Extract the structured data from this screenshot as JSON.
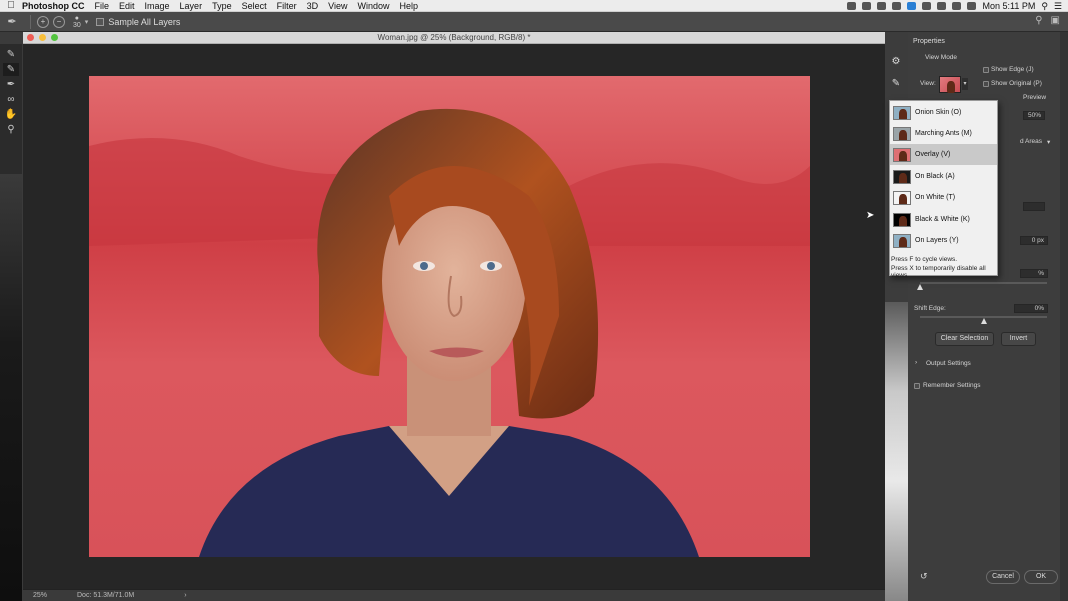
{
  "menubar": {
    "apple_icon": "apple-icon",
    "app_name": "Photoshop CC",
    "menus": [
      "File",
      "Edit",
      "Image",
      "Layer",
      "Type",
      "Select",
      "Filter",
      "3D",
      "View",
      "Window",
      "Help"
    ],
    "clock": "Mon 5:11 PM"
  },
  "optionsbar": {
    "brush_size": "30",
    "sample_all_layers": "Sample All Layers"
  },
  "document": {
    "title": "Woman.jpg @ 25% (Background, RGB/8) *",
    "zoom": "25%",
    "doc_size": "Doc: 51.3M/71.0M",
    "photo_colors": {
      "background": "#db4f55",
      "hair": "#8a3a1a",
      "shirt": "#262a55",
      "skin": "#d9a78d"
    }
  },
  "properties": {
    "panel_title": "Properties",
    "view_mode_label": "View Mode",
    "view_label": "View:",
    "show_edge": "Show Edge (J)",
    "show_original": "Show Original (P)",
    "preview_label": "Preview",
    "opacity_value": "50%",
    "areas_label": "d Areas",
    "px_value": "0 px",
    "pct_fragment": "%",
    "shift_edge_label": "Shift Edge:",
    "shift_edge_value": "0%",
    "shift_edge_level": 0.5,
    "clear_selection": "Clear Selection",
    "invert": "Invert",
    "output_settings": "Output Settings",
    "remember_settings": "Remember Settings",
    "cancel": "Cancel",
    "ok": "OK"
  },
  "view_dropdown": {
    "items": [
      {
        "label": "Onion Skin (O)",
        "thumb": "#8fb0c4",
        "selected": false
      },
      {
        "label": "Marching Ants (M)",
        "thumb": "#9aa4a8",
        "selected": false
      },
      {
        "label": "Overlay (V)",
        "thumb": "#de6f73",
        "selected": true
      },
      {
        "label": "On Black (A)",
        "thumb": "#1a1a1a",
        "selected": false
      },
      {
        "label": "On White (T)",
        "thumb": "#f4f4f4",
        "selected": false
      },
      {
        "label": "Black & White (K)",
        "thumb": "#000000",
        "selected": false
      },
      {
        "label": "On Layers (Y)",
        "thumb": "#8fb0c4",
        "selected": false
      }
    ],
    "hint1": "Press F to cycle views.",
    "hint2": "Press X to temporarily disable all views."
  }
}
